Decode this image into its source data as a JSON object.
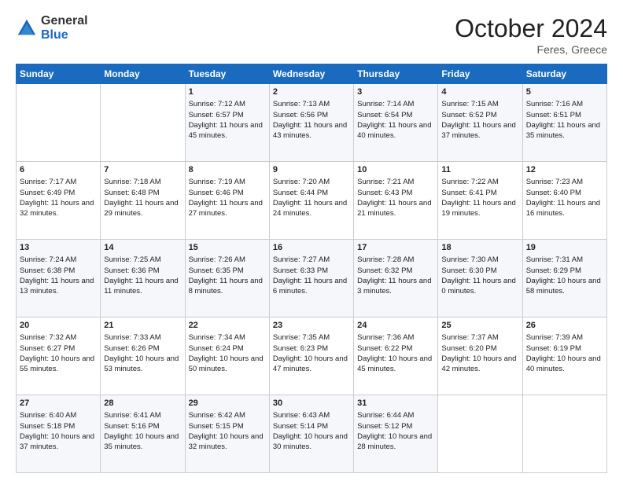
{
  "header": {
    "logo_general": "General",
    "logo_blue": "Blue",
    "month_title": "October 2024",
    "location": "Feres, Greece"
  },
  "days_of_week": [
    "Sunday",
    "Monday",
    "Tuesday",
    "Wednesday",
    "Thursday",
    "Friday",
    "Saturday"
  ],
  "weeks": [
    [
      {
        "day": "",
        "sunrise": "",
        "sunset": "",
        "daylight": ""
      },
      {
        "day": "",
        "sunrise": "",
        "sunset": "",
        "daylight": ""
      },
      {
        "day": "1",
        "sunrise": "Sunrise: 7:12 AM",
        "sunset": "Sunset: 6:57 PM",
        "daylight": "Daylight: 11 hours and 45 minutes."
      },
      {
        "day": "2",
        "sunrise": "Sunrise: 7:13 AM",
        "sunset": "Sunset: 6:56 PM",
        "daylight": "Daylight: 11 hours and 43 minutes."
      },
      {
        "day": "3",
        "sunrise": "Sunrise: 7:14 AM",
        "sunset": "Sunset: 6:54 PM",
        "daylight": "Daylight: 11 hours and 40 minutes."
      },
      {
        "day": "4",
        "sunrise": "Sunrise: 7:15 AM",
        "sunset": "Sunset: 6:52 PM",
        "daylight": "Daylight: 11 hours and 37 minutes."
      },
      {
        "day": "5",
        "sunrise": "Sunrise: 7:16 AM",
        "sunset": "Sunset: 6:51 PM",
        "daylight": "Daylight: 11 hours and 35 minutes."
      }
    ],
    [
      {
        "day": "6",
        "sunrise": "Sunrise: 7:17 AM",
        "sunset": "Sunset: 6:49 PM",
        "daylight": "Daylight: 11 hours and 32 minutes."
      },
      {
        "day": "7",
        "sunrise": "Sunrise: 7:18 AM",
        "sunset": "Sunset: 6:48 PM",
        "daylight": "Daylight: 11 hours and 29 minutes."
      },
      {
        "day": "8",
        "sunrise": "Sunrise: 7:19 AM",
        "sunset": "Sunset: 6:46 PM",
        "daylight": "Daylight: 11 hours and 27 minutes."
      },
      {
        "day": "9",
        "sunrise": "Sunrise: 7:20 AM",
        "sunset": "Sunset: 6:44 PM",
        "daylight": "Daylight: 11 hours and 24 minutes."
      },
      {
        "day": "10",
        "sunrise": "Sunrise: 7:21 AM",
        "sunset": "Sunset: 6:43 PM",
        "daylight": "Daylight: 11 hours and 21 minutes."
      },
      {
        "day": "11",
        "sunrise": "Sunrise: 7:22 AM",
        "sunset": "Sunset: 6:41 PM",
        "daylight": "Daylight: 11 hours and 19 minutes."
      },
      {
        "day": "12",
        "sunrise": "Sunrise: 7:23 AM",
        "sunset": "Sunset: 6:40 PM",
        "daylight": "Daylight: 11 hours and 16 minutes."
      }
    ],
    [
      {
        "day": "13",
        "sunrise": "Sunrise: 7:24 AM",
        "sunset": "Sunset: 6:38 PM",
        "daylight": "Daylight: 11 hours and 13 minutes."
      },
      {
        "day": "14",
        "sunrise": "Sunrise: 7:25 AM",
        "sunset": "Sunset: 6:36 PM",
        "daylight": "Daylight: 11 hours and 11 minutes."
      },
      {
        "day": "15",
        "sunrise": "Sunrise: 7:26 AM",
        "sunset": "Sunset: 6:35 PM",
        "daylight": "Daylight: 11 hours and 8 minutes."
      },
      {
        "day": "16",
        "sunrise": "Sunrise: 7:27 AM",
        "sunset": "Sunset: 6:33 PM",
        "daylight": "Daylight: 11 hours and 6 minutes."
      },
      {
        "day": "17",
        "sunrise": "Sunrise: 7:28 AM",
        "sunset": "Sunset: 6:32 PM",
        "daylight": "Daylight: 11 hours and 3 minutes."
      },
      {
        "day": "18",
        "sunrise": "Sunrise: 7:30 AM",
        "sunset": "Sunset: 6:30 PM",
        "daylight": "Daylight: 11 hours and 0 minutes."
      },
      {
        "day": "19",
        "sunrise": "Sunrise: 7:31 AM",
        "sunset": "Sunset: 6:29 PM",
        "daylight": "Daylight: 10 hours and 58 minutes."
      }
    ],
    [
      {
        "day": "20",
        "sunrise": "Sunrise: 7:32 AM",
        "sunset": "Sunset: 6:27 PM",
        "daylight": "Daylight: 10 hours and 55 minutes."
      },
      {
        "day": "21",
        "sunrise": "Sunrise: 7:33 AM",
        "sunset": "Sunset: 6:26 PM",
        "daylight": "Daylight: 10 hours and 53 minutes."
      },
      {
        "day": "22",
        "sunrise": "Sunrise: 7:34 AM",
        "sunset": "Sunset: 6:24 PM",
        "daylight": "Daylight: 10 hours and 50 minutes."
      },
      {
        "day": "23",
        "sunrise": "Sunrise: 7:35 AM",
        "sunset": "Sunset: 6:23 PM",
        "daylight": "Daylight: 10 hours and 47 minutes."
      },
      {
        "day": "24",
        "sunrise": "Sunrise: 7:36 AM",
        "sunset": "Sunset: 6:22 PM",
        "daylight": "Daylight: 10 hours and 45 minutes."
      },
      {
        "day": "25",
        "sunrise": "Sunrise: 7:37 AM",
        "sunset": "Sunset: 6:20 PM",
        "daylight": "Daylight: 10 hours and 42 minutes."
      },
      {
        "day": "26",
        "sunrise": "Sunrise: 7:39 AM",
        "sunset": "Sunset: 6:19 PM",
        "daylight": "Daylight: 10 hours and 40 minutes."
      }
    ],
    [
      {
        "day": "27",
        "sunrise": "Sunrise: 6:40 AM",
        "sunset": "Sunset: 5:18 PM",
        "daylight": "Daylight: 10 hours and 37 minutes."
      },
      {
        "day": "28",
        "sunrise": "Sunrise: 6:41 AM",
        "sunset": "Sunset: 5:16 PM",
        "daylight": "Daylight: 10 hours and 35 minutes."
      },
      {
        "day": "29",
        "sunrise": "Sunrise: 6:42 AM",
        "sunset": "Sunset: 5:15 PM",
        "daylight": "Daylight: 10 hours and 32 minutes."
      },
      {
        "day": "30",
        "sunrise": "Sunrise: 6:43 AM",
        "sunset": "Sunset: 5:14 PM",
        "daylight": "Daylight: 10 hours and 30 minutes."
      },
      {
        "day": "31",
        "sunrise": "Sunrise: 6:44 AM",
        "sunset": "Sunset: 5:12 PM",
        "daylight": "Daylight: 10 hours and 28 minutes."
      },
      {
        "day": "",
        "sunrise": "",
        "sunset": "",
        "daylight": ""
      },
      {
        "day": "",
        "sunrise": "",
        "sunset": "",
        "daylight": ""
      }
    ]
  ]
}
